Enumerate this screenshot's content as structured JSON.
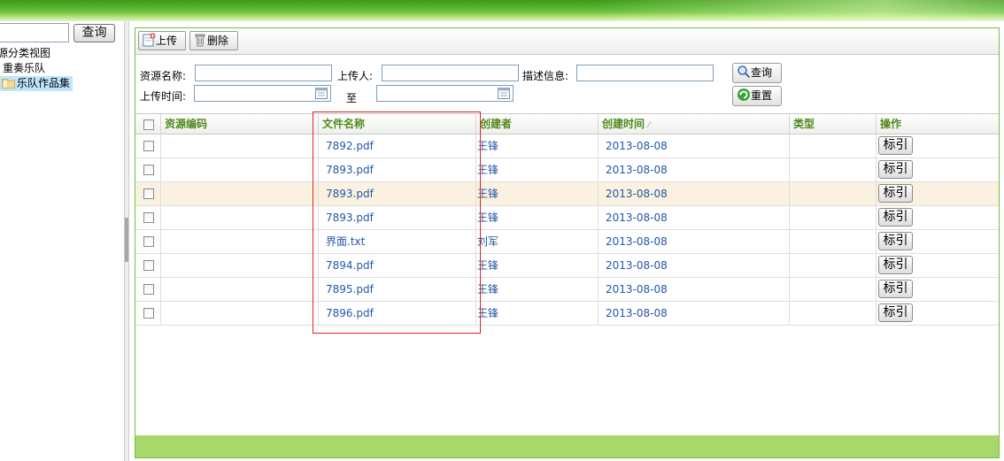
{
  "left": {
    "search_value": "",
    "search_button": "查询",
    "tree": [
      {
        "label": "源分类视图",
        "level": 0
      },
      {
        "label": "重奏乐队",
        "level": 1
      },
      {
        "label": "乐队作品集",
        "level": 1,
        "selected": true,
        "icon": "folder-icon"
      }
    ]
  },
  "toolbar": {
    "upload_label": "上传",
    "delete_label": "删除"
  },
  "filter": {
    "resource_name_label": "资源名称:",
    "resource_name_value": "",
    "uploader_label": "上传人:",
    "uploader_value": "",
    "description_label": "描述信息:",
    "description_value": "",
    "upload_time_label": "上传时间:",
    "date_from_value": "",
    "to_label": "至",
    "date_to_value": "",
    "query_button": "查询",
    "reset_button": "重置"
  },
  "grid": {
    "columns": [
      "资源编码",
      "文件名称",
      "创建者",
      "创建时间",
      "类型",
      "操作"
    ],
    "sort_indicator": "⁄",
    "action_label": "标引",
    "rows": [
      {
        "code": "",
        "file": "7892.pdf",
        "creator": "王锋",
        "created": "2013-08-08",
        "type": ""
      },
      {
        "code": "",
        "file": "7893.pdf",
        "creator": "王锋",
        "created": "2013-08-08",
        "type": ""
      },
      {
        "code": "",
        "file": "7893.pdf",
        "creator": "王锋",
        "created": "2013-08-08",
        "type": ""
      },
      {
        "code": "",
        "file": "7893.pdf",
        "creator": "王锋",
        "created": "2013-08-08",
        "type": ""
      },
      {
        "code": "",
        "file": "界面.txt",
        "creator": "刘军",
        "created": "2013-08-08",
        "type": ""
      },
      {
        "code": "",
        "file": "7894.pdf",
        "creator": "王锋",
        "created": "2013-08-08",
        "type": ""
      },
      {
        "code": "",
        "file": "7895.pdf",
        "creator": "王锋",
        "created": "2013-08-08",
        "type": ""
      },
      {
        "code": "",
        "file": "7896.pdf",
        "creator": "王锋",
        "created": "2013-08-08",
        "type": ""
      }
    ],
    "highlighted_row": 2
  },
  "colors": {
    "accent_green": "#6ec43c",
    "header_text": "#4f8a1b",
    "link_blue": "#2257a8",
    "highlight_row": "#fbf1e1",
    "annotation_red": "#e02020"
  }
}
